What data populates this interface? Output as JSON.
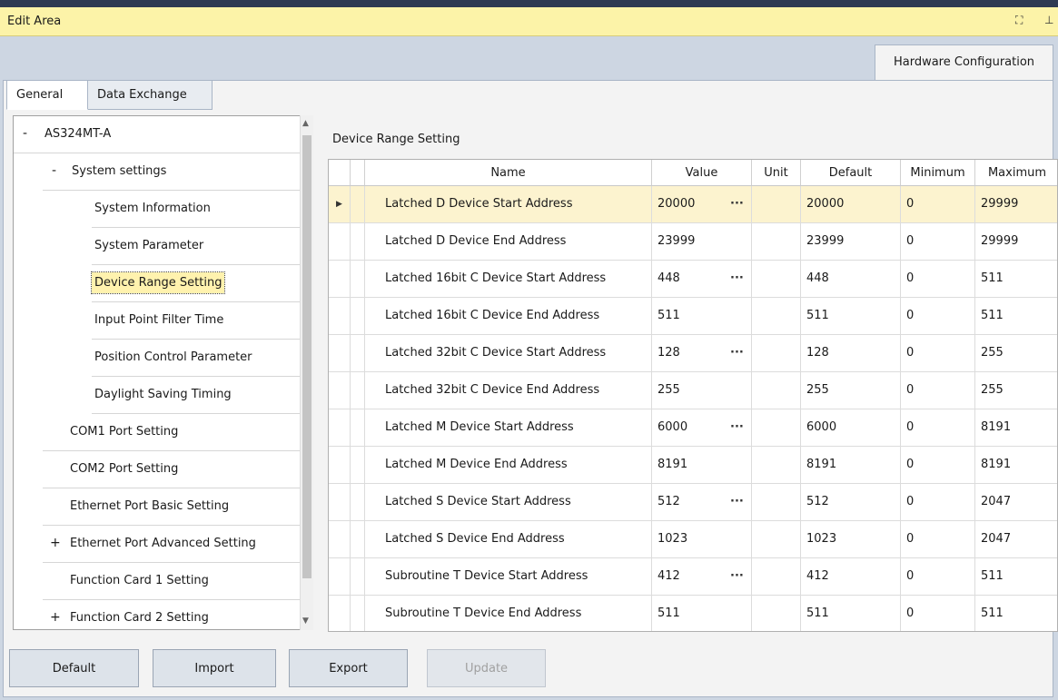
{
  "window": {
    "title": "Edit Area",
    "title_icons": [
      "restore-icon",
      "pin-icon"
    ],
    "hw_tab": "Hardware Configuration"
  },
  "tabs": [
    "General",
    "Data Exchange"
  ],
  "tree": {
    "items": [
      {
        "toggle": "-",
        "label": "AS324MT-A"
      },
      {
        "toggle": "-",
        "label": "System settings"
      },
      {
        "toggle": "",
        "label": "System Information"
      },
      {
        "toggle": "",
        "label": "System Parameter"
      },
      {
        "toggle": "",
        "label": "Device Range Setting",
        "selected": true
      },
      {
        "toggle": "",
        "label": "Input Point Filter Time"
      },
      {
        "toggle": "",
        "label": "Position Control Parameter"
      },
      {
        "toggle": "",
        "label": "Daylight Saving Timing"
      },
      {
        "toggle": "",
        "label": "COM1 Port Setting"
      },
      {
        "toggle": "",
        "label": "COM2 Port Setting"
      },
      {
        "toggle": "",
        "label": "Ethernet Port Basic Setting"
      },
      {
        "toggle": "+",
        "label": "Ethernet Port Advanced Setting"
      },
      {
        "toggle": "",
        "label": "Function Card 1 Setting"
      },
      {
        "toggle": "+",
        "label": "Function Card 2 Setting"
      }
    ]
  },
  "main": {
    "section_title": "Device Range Setting",
    "columns": [
      "Name",
      "Value",
      "Unit",
      "Default",
      "Minimum",
      "Maximum"
    ],
    "ellipsis": "···",
    "rows": [
      {
        "name": "Latched D Device Start Address",
        "value": "20000",
        "unit": "",
        "default": "20000",
        "min": "0",
        "max": "29999",
        "has_ellipsis": true,
        "selected": true
      },
      {
        "name": "Latched D Device End Address",
        "value": "23999",
        "unit": "",
        "default": "23999",
        "min": "0",
        "max": "29999",
        "has_ellipsis": false
      },
      {
        "name": "Latched 16bit C Device Start Address",
        "value": "448",
        "unit": "",
        "default": "448",
        "min": "0",
        "max": "511",
        "has_ellipsis": true
      },
      {
        "name": "Latched 16bit C Device End Address",
        "value": "511",
        "unit": "",
        "default": "511",
        "min": "0",
        "max": "511",
        "has_ellipsis": false
      },
      {
        "name": "Latched 32bit C Device Start Address",
        "value": "128",
        "unit": "",
        "default": "128",
        "min": "0",
        "max": "255",
        "has_ellipsis": true
      },
      {
        "name": "Latched 32bit C Device End Address",
        "value": "255",
        "unit": "",
        "default": "255",
        "min": "0",
        "max": "255",
        "has_ellipsis": false
      },
      {
        "name": "Latched M Device Start Address",
        "value": "6000",
        "unit": "",
        "default": "6000",
        "min": "0",
        "max": "8191",
        "has_ellipsis": true
      },
      {
        "name": "Latched M Device End Address",
        "value": "8191",
        "unit": "",
        "default": "8191",
        "min": "0",
        "max": "8191",
        "has_ellipsis": false
      },
      {
        "name": "Latched S Device Start Address",
        "value": "512",
        "unit": "",
        "default": "512",
        "min": "0",
        "max": "2047",
        "has_ellipsis": true
      },
      {
        "name": "Latched S Device End Address",
        "value": "1023",
        "unit": "",
        "default": "1023",
        "min": "0",
        "max": "2047",
        "has_ellipsis": false
      },
      {
        "name": "Subroutine T Device Start Address",
        "value": "412",
        "unit": "",
        "default": "412",
        "min": "0",
        "max": "511",
        "has_ellipsis": true
      },
      {
        "name": "Subroutine T Device End Address",
        "value": "511",
        "unit": "",
        "default": "511",
        "min": "0",
        "max": "511",
        "has_ellipsis": false
      }
    ]
  },
  "buttons": {
    "default": "Default",
    "import": "Import",
    "export": "Export",
    "update": "Update"
  },
  "colors": {
    "title_bar": "#fcf3a8",
    "selection": "#fff2ae",
    "panel_bg": "#cdd6e2"
  }
}
